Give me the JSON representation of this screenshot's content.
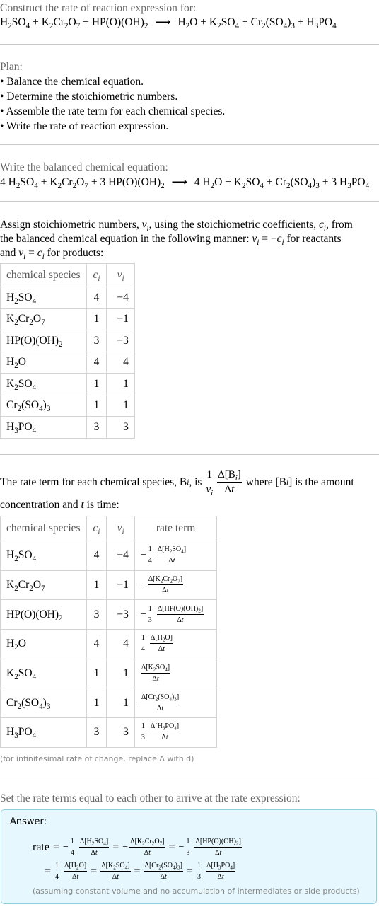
{
  "intro": {
    "title": "Construct the rate of reaction expression for:",
    "equation": {
      "reactants": [
        "H<sub>2</sub>SO<sub>4</sub>",
        "K<sub>2</sub>Cr<sub>2</sub>O<sub>7</sub>",
        "HP(O)(OH)<sub>2</sub>"
      ],
      "products": [
        "H<sub>2</sub>O",
        "K<sub>2</sub>SO<sub>4</sub>",
        "Cr<sub>2</sub>(SO<sub>4</sub>)<sub>3</sub>",
        "H<sub>3</sub>PO<sub>4</sub>"
      ],
      "arrow": "⟶",
      "plus": "+"
    }
  },
  "plan": {
    "heading": "Plan:",
    "items": [
      "• Balance the chemical equation.",
      "• Determine the stoichiometric numbers.",
      "• Assemble the rate term for each chemical species.",
      "• Write the rate of reaction expression."
    ]
  },
  "balanced": {
    "heading": "Write the balanced chemical equation:",
    "reactants": [
      "4 H<sub>2</sub>SO<sub>4</sub>",
      "K<sub>2</sub>Cr<sub>2</sub>O<sub>7</sub>",
      "3 HP(O)(OH)<sub>2</sub>"
    ],
    "products": [
      "4 H<sub>2</sub>O",
      "K<sub>2</sub>SO<sub>4</sub>",
      "Cr<sub>2</sub>(SO<sub>4</sub>)<sub>3</sub>",
      "3 H<sub>3</sub>PO<sub>4</sub>"
    ]
  },
  "stoich": {
    "text_html": "Assign stoichiometric numbers, <i>ν<sub>i</sub></i>, using the stoichiometric coefficients, <i>c<sub>i</sub></i>, from<br>the balanced chemical equation in the following manner: <i>ν<sub>i</sub></i> = −<i>c<sub>i</sub></i> for reactants<br>and <i>ν<sub>i</sub></i> = <i>c<sub>i</sub></i> for products:",
    "columns": [
      "chemical species",
      "c_i",
      "ν_i"
    ],
    "rows": [
      {
        "species": "H<sub>2</sub>SO<sub>4</sub>",
        "c": "4",
        "nu": "−4"
      },
      {
        "species": "K<sub>2</sub>Cr<sub>2</sub>O<sub>7</sub>",
        "c": "1",
        "nu": "−1"
      },
      {
        "species": "HP(O)(OH)<sub>2</sub>",
        "c": "3",
        "nu": "−3"
      },
      {
        "species": "H<sub>2</sub>O",
        "c": "4",
        "nu": "4"
      },
      {
        "species": "K<sub>2</sub>SO<sub>4</sub>",
        "c": "1",
        "nu": "1"
      },
      {
        "species": "Cr<sub>2</sub>(SO<sub>4</sub>)<sub>3</sub>",
        "c": "1",
        "nu": "1"
      },
      {
        "species": "H<sub>3</sub>PO<sub>4</sub>",
        "c": "3",
        "nu": "3"
      }
    ]
  },
  "rateterm": {
    "text_before": "The rate term for each chemical species, B",
    "text_mid": ", is",
    "text_after": "where [B",
    "text_after2": "] is the amount",
    "line2": "concentration and",
    "line2b": "is time:",
    "columns": [
      "chemical species",
      "c_i",
      "ν_i",
      "rate term"
    ],
    "rows": [
      {
        "species": "H<sub>2</sub>SO<sub>4</sub>",
        "c": "4",
        "nu": "−4",
        "sign": "−",
        "coef": "4",
        "conc": "H<sub>2</sub>SO<sub>4</sub>"
      },
      {
        "species": "K<sub>2</sub>Cr<sub>2</sub>O<sub>7</sub>",
        "c": "1",
        "nu": "−1",
        "sign": "−",
        "coef": "",
        "conc": "K<sub>2</sub>Cr<sub>2</sub>O<sub>7</sub>"
      },
      {
        "species": "HP(O)(OH)<sub>2</sub>",
        "c": "3",
        "nu": "−3",
        "sign": "−",
        "coef": "3",
        "conc": "HP(O)(OH)<sub>2</sub>"
      },
      {
        "species": "H<sub>2</sub>O",
        "c": "4",
        "nu": "4",
        "sign": "",
        "coef": "4",
        "conc": "H<sub>2</sub>O"
      },
      {
        "species": "K<sub>2</sub>SO<sub>4</sub>",
        "c": "1",
        "nu": "1",
        "sign": "",
        "coef": "",
        "conc": "K<sub>2</sub>SO<sub>4</sub>"
      },
      {
        "species": "Cr<sub>2</sub>(SO<sub>4</sub>)<sub>3</sub>",
        "c": "1",
        "nu": "1",
        "sign": "",
        "coef": "",
        "conc": "Cr<sub>2</sub>(SO<sub>4</sub>)<sub>3</sub>"
      },
      {
        "species": "H<sub>3</sub>PO<sub>4</sub>",
        "c": "3",
        "nu": "3",
        "sign": "",
        "coef": "3",
        "conc": "H<sub>3</sub>PO<sub>4</sub>"
      }
    ],
    "note": "(for infinitesimal rate of change, replace Δ with d)"
  },
  "final": {
    "heading": "Set the rate terms equal to each other to arrive at the rate expression:",
    "answer_label": "Answer:",
    "rate_word": "rate",
    "assumption": "(assuming constant volume and no accumulation of intermediates or side products)"
  },
  "colors": {
    "answer_bg": "#e6f7fd",
    "answer_border": "#8fd0e0",
    "divider": "#c8c8c8",
    "label_gray": "#666666"
  }
}
